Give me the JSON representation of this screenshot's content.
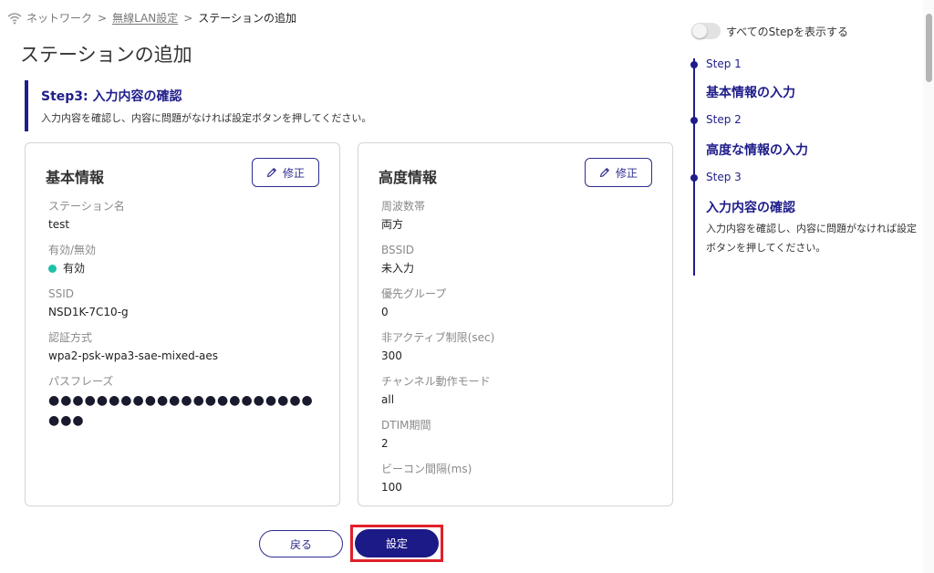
{
  "breadcrumb": {
    "network": "ネットワーク",
    "separator": ">",
    "wlan": "無線LAN設定",
    "current": "ステーションの追加"
  },
  "page_title": "ステーションの追加",
  "step_header": {
    "title": "Step3: 入力内容の確認",
    "description": "入力内容を確認し、内容に問題がなければ設定ボタンを押してください。"
  },
  "basic_card": {
    "title": "基本情報",
    "edit_label": "修正",
    "fields": [
      {
        "label": "ステーション名",
        "value": "test"
      },
      {
        "label": "有効/無効",
        "value": "有効"
      },
      {
        "label": "SSID",
        "value": "NSD1K-7C10-g"
      },
      {
        "label": "認証方式",
        "value": "wpa2-psk-wpa3-sae-mixed-aes"
      },
      {
        "label": "パスフレーズ",
        "value": "●●●●●●●●●●●●●●●●●●●●●●●●●"
      }
    ]
  },
  "advanced_card": {
    "title": "高度情報",
    "edit_label": "修正",
    "fields": [
      {
        "label": "周波数帯",
        "value": "両方"
      },
      {
        "label": "BSSID",
        "value": "未入力"
      },
      {
        "label": "優先グループ",
        "value": "0"
      },
      {
        "label": "非アクティブ制限(sec)",
        "value": "300"
      },
      {
        "label": "チャンネル動作モード",
        "value": "all"
      },
      {
        "label": "DTIM期間",
        "value": "2"
      },
      {
        "label": "ビーコン間隔(ms)",
        "value": "100"
      }
    ]
  },
  "buttons": {
    "back": "戻る",
    "submit": "設定"
  },
  "side_panel": {
    "toggle_label": "すべてのStepを表示する",
    "steps": [
      {
        "step": "Step 1",
        "title": "基本情報の入力"
      },
      {
        "step": "Step 2",
        "title": "高度な情報の入力"
      },
      {
        "step": "Step 3",
        "title": "入力内容の確認",
        "description": "入力内容を確認し、内容に問題がなければ設定ボタンを押してください。"
      }
    ]
  },
  "colors": {
    "accent": "#1f1d8a",
    "status_enabled": "#1fbfa8",
    "highlight_frame": "#e0202a"
  }
}
